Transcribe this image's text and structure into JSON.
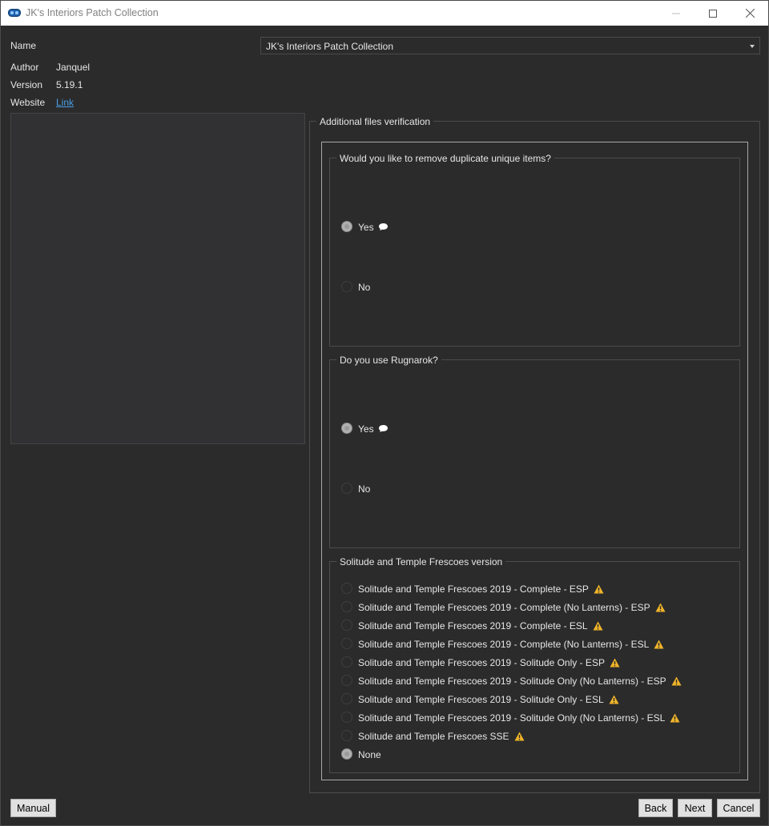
{
  "window": {
    "title": "JK's Interiors Patch Collection",
    "app_icon": "mod-organizer-icon"
  },
  "info": {
    "name_label": "Name",
    "name_value": "JK's Interiors Patch Collection",
    "author_label": "Author",
    "author_value": "Janquel",
    "version_label": "Version",
    "version_value": "5.19.1",
    "website_label": "Website",
    "website_link": "Link"
  },
  "step": {
    "title": "Additional files verification"
  },
  "groups": [
    {
      "title": "Would you like to remove duplicate unique items?",
      "options": [
        {
          "label": "Yes",
          "checked": true,
          "icon": "comment-icon"
        },
        {
          "label": "No",
          "checked": false
        }
      ]
    },
    {
      "title": "Do you use Rugnarok?",
      "options": [
        {
          "label": "Yes",
          "checked": true,
          "icon": "comment-icon"
        },
        {
          "label": "No",
          "checked": false
        }
      ]
    },
    {
      "title": "Solitude and Temple Frescoes version",
      "options": [
        {
          "label": "Solitude and Temple Frescoes 2019 - Complete - ESP",
          "checked": false,
          "icon": "warning-icon"
        },
        {
          "label": "Solitude and Temple Frescoes 2019 - Complete (No Lanterns) - ESP",
          "checked": false,
          "icon": "warning-icon"
        },
        {
          "label": "Solitude and Temple Frescoes 2019 - Complete - ESL",
          "checked": false,
          "icon": "warning-icon"
        },
        {
          "label": "Solitude and Temple Frescoes 2019 - Complete (No Lanterns) - ESL",
          "checked": false,
          "icon": "warning-icon"
        },
        {
          "label": "Solitude and Temple Frescoes 2019 - Solitude Only - ESP",
          "checked": false,
          "icon": "warning-icon"
        },
        {
          "label": "Solitude and Temple Frescoes 2019 - Solitude Only (No Lanterns) - ESP",
          "checked": false,
          "icon": "warning-icon"
        },
        {
          "label": "Solitude and Temple Frescoes 2019 - Solitude Only - ESL",
          "checked": false,
          "icon": "warning-icon"
        },
        {
          "label": "Solitude and Temple Frescoes 2019 - Solitude Only (No Lanterns) - ESL",
          "checked": false,
          "icon": "warning-icon"
        },
        {
          "label": "Solitude and Temple Frescoes SSE",
          "checked": false,
          "icon": "warning-icon"
        },
        {
          "label": "None",
          "checked": true
        }
      ]
    }
  ],
  "buttons": {
    "manual": "Manual",
    "back": "Back",
    "next": "Next",
    "cancel": "Cancel"
  },
  "colors": {
    "background": "#2b2b2b",
    "link": "#4a9fe8",
    "warning": "#f0b429"
  }
}
